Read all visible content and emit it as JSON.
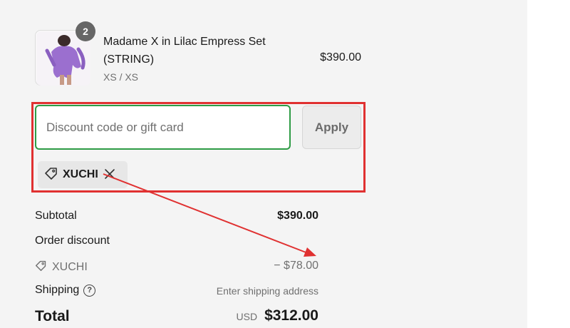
{
  "product": {
    "quantity": "2",
    "title": "Madame X in Lilac Empress Set (STRING)",
    "variant": "XS / XS",
    "price": "$390.00",
    "image_icon": "product-thumbnail"
  },
  "discount": {
    "placeholder": "Discount code or gift card",
    "value": "",
    "apply_label": "Apply",
    "applied_code": "XUCHI",
    "remove_icon": "close-icon"
  },
  "summary": {
    "subtotal_label": "Subtotal",
    "subtotal_value": "$390.00",
    "order_discount_label": "Order discount",
    "discount_code": "XUCHI",
    "discount_value": "− $78.00",
    "shipping_label": "Shipping",
    "shipping_value": "Enter shipping address",
    "total_label": "Total",
    "currency": "USD",
    "total_value": "$312.00"
  },
  "colors": {
    "annotation": "#e03131",
    "input_focus": "#2e9c45",
    "badge": "#666666"
  }
}
